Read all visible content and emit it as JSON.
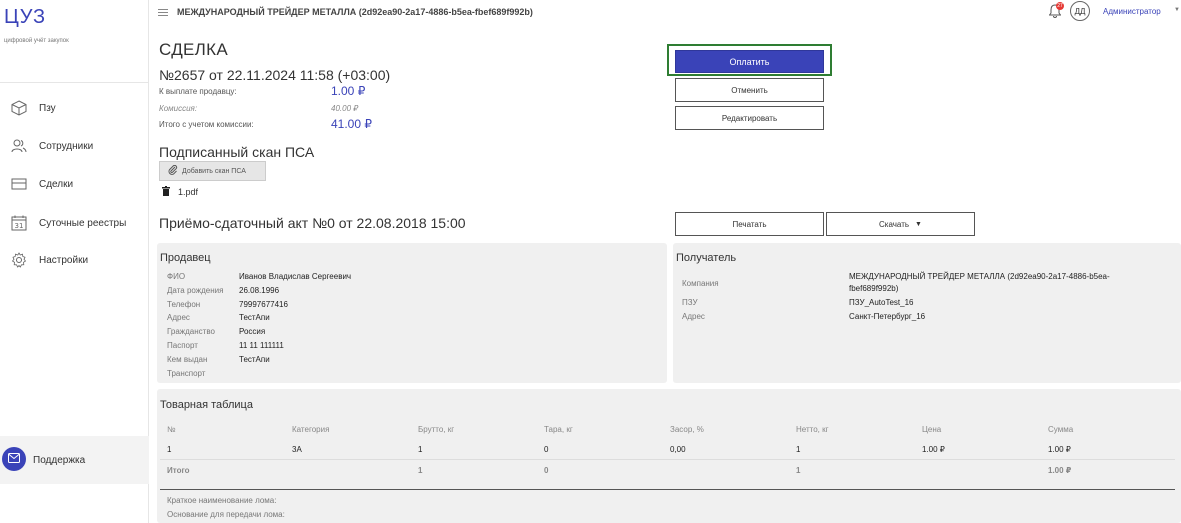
{
  "sidebar": {
    "logo": "ЦУЗ",
    "logo_sub": "цифровой учёт закупок",
    "items": [
      {
        "label": "Пзу",
        "icon": "cube-icon"
      },
      {
        "label": "Сотрудники",
        "icon": "users-icon"
      },
      {
        "label": "Сделки",
        "icon": "deals-icon"
      },
      {
        "label": "Суточные реестры",
        "icon": "calendar-icon"
      },
      {
        "label": "Настройки",
        "icon": "gear-icon"
      }
    ],
    "support_label": "Поддержка"
  },
  "header": {
    "org_title": "МЕЖДУНАРОДНЫЙ ТРЕЙДЕР МЕТАЛЛА (2d92ea90-2a17-4886-b5ea-fbef689f992b)",
    "notification_count": "27",
    "avatar_initials": "ДД",
    "user_name": "Администратор",
    "user_caret": "▼"
  },
  "deal": {
    "title": "СДЕЛКА",
    "number": "№2657 от 22.11.2024 11:58 (+03:00)",
    "to_seller_label": "К выплате продавцу:",
    "to_seller_value": "1.00 ₽",
    "commission_label": "Комиссия:",
    "commission_value": "40.00 ₽",
    "total_label": "Итого с учетом комиссии:",
    "total_value": "41.00 ₽"
  },
  "actions": {
    "pay": "Оплатить",
    "cancel": "Отменить",
    "edit": "Редактировать",
    "print": "Печатать",
    "download": "Скачать"
  },
  "scan": {
    "title": "Подписанный скан ПСА",
    "add_button": "Добавить скан ПСА",
    "file_name": "1.pdf"
  },
  "act": {
    "title": "Приёмо-сдаточный акт №0 от 22.08.2018 15:00"
  },
  "seller": {
    "title": "Продавец",
    "fields": [
      {
        "label": "ФИО",
        "value": "Иванов Владислав Сергеевич"
      },
      {
        "label": "Дата рождения",
        "value": "26.08.1996"
      },
      {
        "label": "Телефон",
        "value": "79997677416"
      },
      {
        "label": "Адрес",
        "value": "ТестАпи"
      },
      {
        "label": "Гражданство",
        "value": "Россия"
      },
      {
        "label": "Паспорт",
        "value": "11 11 111111"
      },
      {
        "label": "Кем выдан",
        "value": "ТестАпи"
      },
      {
        "label": "Транспорт",
        "value": ""
      }
    ]
  },
  "recipient": {
    "title": "Получатель",
    "fields": [
      {
        "label": "Компания",
        "value_line1": "МЕЖДУНАРОДНЫЙ ТРЕЙДЕР МЕТАЛЛА (2d92ea90-2a17-4886-b5ea-",
        "value_line2": "fbef689f992b)"
      },
      {
        "label": "ПЗУ",
        "value": "ПЗУ_AutoTest_16"
      },
      {
        "label": "Адрес",
        "value": "Санкт-Петербург_16"
      }
    ]
  },
  "goods": {
    "title": "Товарная таблица",
    "headers": [
      "№",
      "Категория",
      "Брутто, кг",
      "Тара, кг",
      "Засор, %",
      "Нетто, кг",
      "Цена",
      "Сумма"
    ],
    "rows": [
      [
        "1",
        "3А",
        "1",
        "0",
        "0,00",
        "1",
        "1.00 ₽",
        "1.00 ₽"
      ]
    ],
    "total": [
      "Итого",
      "",
      "1",
      "0",
      "",
      "1",
      "",
      "1.00 ₽"
    ],
    "short_name_label": "Краткое наименование лома:",
    "basis_label": "Основание для передачи лома:"
  },
  "colors": {
    "accent": "#3a43b8",
    "pay_frame": "#2e7d32",
    "card_bg": "#f0f0f0"
  }
}
